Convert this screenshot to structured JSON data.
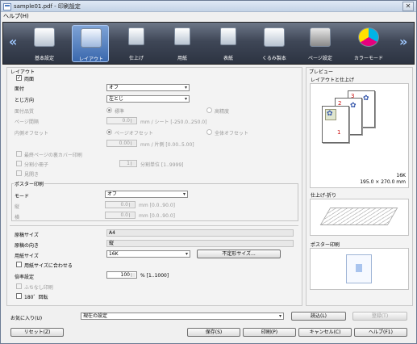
{
  "window": {
    "title": "sample01.pdf - 印刷設定"
  },
  "menu": [
    "ヘルプ(H)"
  ],
  "toolbar": {
    "items": [
      {
        "label": "基本設定",
        "icon": "basic-settings-icon"
      },
      {
        "label": "レイアウト",
        "icon": "layout-icon",
        "selected": true
      },
      {
        "label": "仕上げ",
        "icon": "finishing-icon"
      },
      {
        "label": "用紙",
        "icon": "paper-icon"
      },
      {
        "label": "表紙",
        "icon": "cover-icon"
      },
      {
        "label": "くるみ製本",
        "icon": "perfect-binding-icon"
      },
      {
        "label": "ページ設定",
        "icon": "page-settings-icon"
      },
      {
        "label": "カラーモード",
        "icon": "color-mode-icon"
      }
    ]
  },
  "layout": {
    "group_title": "レイアウト",
    "duplex_label": "両面",
    "duplex_checked": true,
    "imposition_label": "面付",
    "imposition_value": "オフ",
    "binding_label": "とじ方向",
    "binding_value": "左とじ",
    "quality_label": "面付品質",
    "quality_standard": "標準",
    "quality_high": "高精度",
    "page_gap_label": "ページ間隔",
    "page_gap_value": "0.0",
    "page_gap_unit": "mm / シート [-250.0..250.0]",
    "inner_offset_label": "内側オフセット",
    "page_offset": "ページオフセット",
    "whole_offset": "全体オフセット",
    "offset_value": "0.00",
    "offset_unit": "mm / 片側 [0.00..5.00]",
    "last_page_back": "最終ページの裏カバー印刷",
    "split_booklet": "分割小冊子",
    "split_value": "1",
    "split_unit": "分割単位 [1..9999]",
    "spread": "見開き"
  },
  "poster": {
    "group_title": "ポスター印刷",
    "mode_label": "モード",
    "mode_value": "オフ",
    "vertical_label": "縦",
    "vertical_value": "0.0",
    "vertical_unit": "mm [0.0..90.0]",
    "horizontal_label": "横",
    "horizontal_value": "0.0",
    "horizontal_unit": "mm [0.0..90.0]"
  },
  "paper": {
    "original_size_label": "原稿サイズ",
    "original_size_value": "A4",
    "original_orientation_label": "原稿の向き",
    "original_orientation_value": "縦",
    "paper_size_label": "用紙サイズ",
    "paper_size_value": "16K",
    "irregular_size_button": "不定形サイズ...",
    "fit_to_paper": "用紙サイズに合わせる",
    "scale_label": "倍率設定",
    "scale_value": "100",
    "scale_unit": "% [1..1000]",
    "borderless": "ふちなし印刷",
    "rotate": "180゜回転"
  },
  "preview": {
    "group_title": "プレビュー",
    "layout_finish_label": "レイアウトと仕上げ",
    "page_size_label": "16K",
    "page_dimensions": "195.0 × 270.0 mm",
    "finish_fold_label": "仕上げ-折り",
    "poster_label": "ポスター印刷",
    "page_numbers": [
      "3",
      "2",
      "1"
    ]
  },
  "favorites": {
    "label": "お気に入り(U)",
    "value": "現在の設定",
    "load_button": "読込(L)",
    "register_button": "登録(T)"
  },
  "footer": {
    "reset_button": "リセット(Z)",
    "save_button": "保存(S)",
    "print_button": "印刷(P)",
    "cancel_button": "キャンセル(C)",
    "help_button": "ヘルプ(F1)"
  },
  "colors": {
    "toolbar_bg": "#3f4757",
    "selected_tool": "#3a68ad",
    "page_number_red": "#cc1111",
    "flower_blue": "#3355aa"
  }
}
